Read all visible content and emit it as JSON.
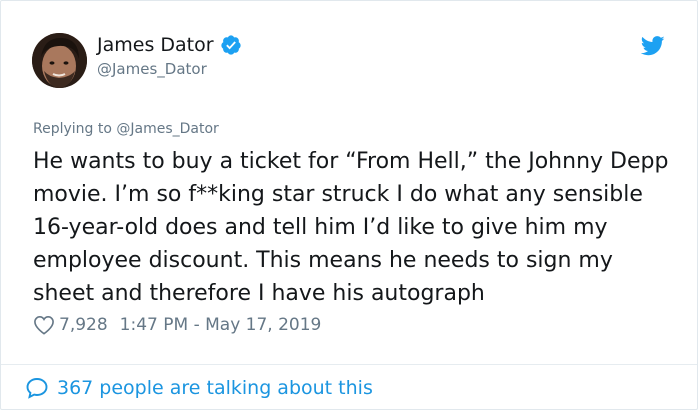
{
  "author": {
    "display_name": "James Dator",
    "handle": "@James_Dator",
    "verified_icon": "verified-badge-icon",
    "avatar_icon": "profile-photo"
  },
  "brand": {
    "logo_icon": "twitter-bird-icon",
    "accent_color": "#1da1f2",
    "link_color": "#1b95e0",
    "secondary_text_color": "#657786"
  },
  "tweet": {
    "replying_to": "Replying to @James_Dator",
    "text": "He wants to buy a ticket for “From Hell,” the Johnny Depp movie. I’m so f**king star struck I do what any sensible 16-year-old does and tell him I’d like to give him my employee discount. This means he needs to sign my sheet and therefore I have his autograph",
    "like_icon": "heart-outline-icon",
    "like_count": "7,928",
    "timestamp": "1:47 PM - May 17, 2019"
  },
  "footer": {
    "icon": "speech-bubble-icon",
    "talking_text": "367 people are talking about this"
  }
}
